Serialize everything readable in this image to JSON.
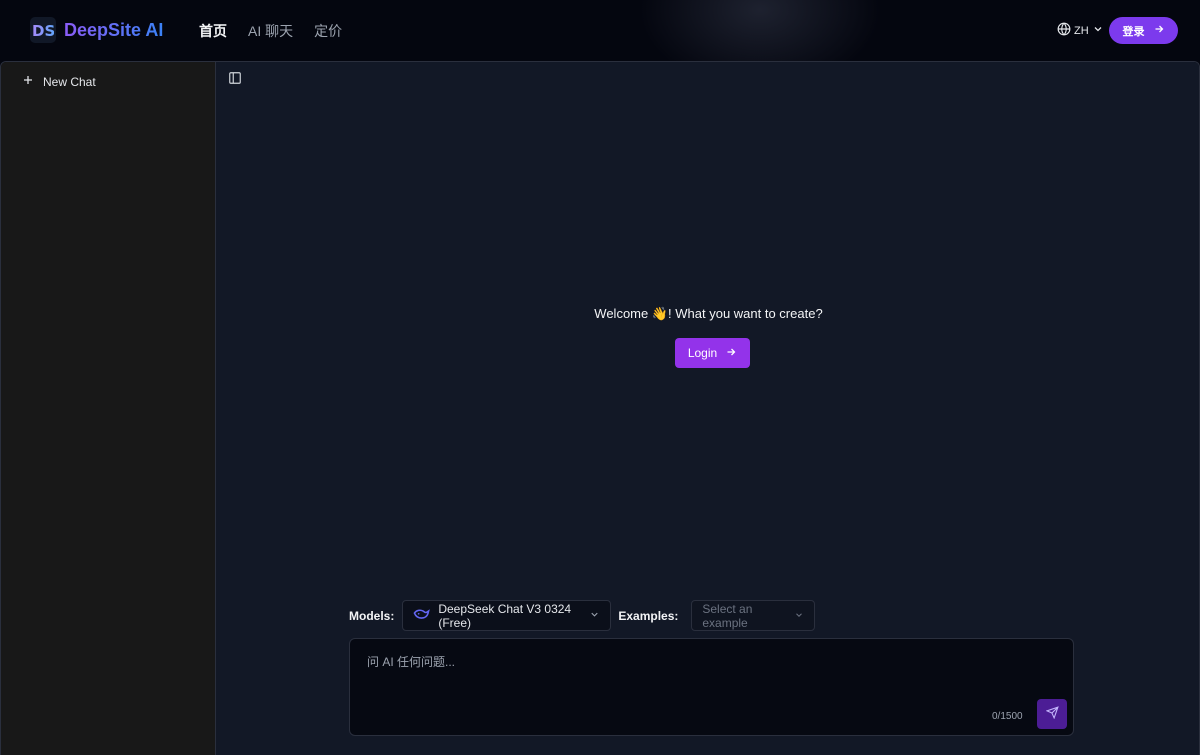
{
  "header": {
    "logo_text": "DeepSite AI",
    "logo_mark": "DS",
    "nav": [
      {
        "label": "首页",
        "active": true
      },
      {
        "label": "AI 聊天",
        "active": false
      },
      {
        "label": "定价",
        "active": false
      }
    ],
    "language": "ZH",
    "signin_label": "登录"
  },
  "sidebar": {
    "new_chat_label": "New Chat"
  },
  "main": {
    "welcome_text": "Welcome 👋! What you want to create?",
    "login_label": "Login",
    "models_label": "Models:",
    "model_value": "DeepSeek Chat V3 0324 (Free)",
    "examples_label": "Examples:",
    "examples_placeholder": "Select an example",
    "prompt_placeholder": "问 AI 任何问题...",
    "counter": "0/1500"
  },
  "colors": {
    "accent": "#9333ea",
    "signin": "#7c3aed",
    "background": "#121826",
    "sidebar": "#181818"
  },
  "icons": [
    "globe-icon",
    "chevron-down-icon",
    "arrow-right-icon",
    "plus-icon",
    "sidebar-toggle-icon",
    "whale-icon",
    "send-icon"
  ]
}
